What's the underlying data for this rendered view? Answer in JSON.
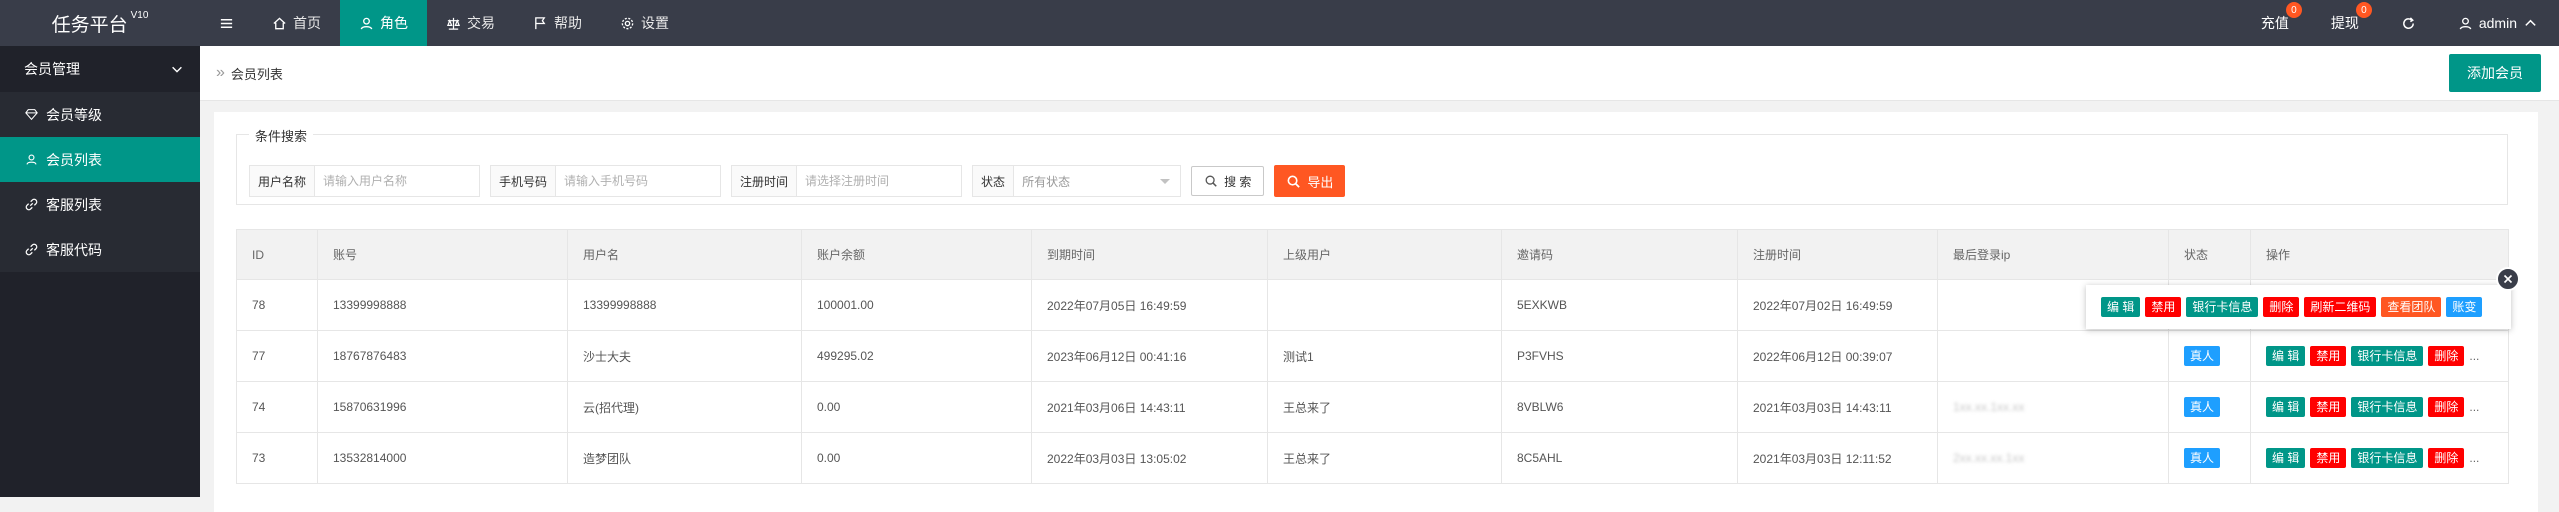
{
  "app": {
    "title": "任务平台",
    "version": "V10"
  },
  "topnav": [
    {
      "label": "",
      "icon": "menu-icon"
    },
    {
      "label": "首页",
      "icon": "home-icon"
    },
    {
      "label": "角色",
      "icon": "user-icon",
      "active": true
    },
    {
      "label": "交易",
      "icon": "scale-icon"
    },
    {
      "label": "帮助",
      "icon": "flag-icon"
    },
    {
      "label": "设置",
      "icon": "gear-icon"
    }
  ],
  "topright": {
    "recharge": {
      "label": "充值",
      "badge": "0"
    },
    "withdraw": {
      "label": "提现",
      "badge": "0"
    },
    "refresh_icon": "refresh-icon",
    "user": "admin"
  },
  "sidebar": {
    "group": "会员管理",
    "items": [
      {
        "label": "会员等级",
        "icon": "diamond-icon"
      },
      {
        "label": "会员列表",
        "icon": "user-icon",
        "active": true
      },
      {
        "label": "客服列表",
        "icon": "link-icon"
      },
      {
        "label": "客服代码",
        "icon": "link-icon"
      }
    ]
  },
  "header": {
    "breadcrumb": "会员列表",
    "add_button": "添加会员"
  },
  "search": {
    "legend": "条件搜索",
    "fields": [
      {
        "label": "用户名称",
        "placeholder": "请输入用户名称"
      },
      {
        "label": "手机号码",
        "placeholder": "请输入手机号码"
      },
      {
        "label": "注册时间",
        "placeholder": "请选择注册时间"
      }
    ],
    "status": {
      "label": "状态",
      "value": "所有状态"
    },
    "search_button": "搜 索",
    "export_button": "导出"
  },
  "table": {
    "columns": [
      "ID",
      "账号",
      "用户名",
      "账户余额",
      "到期时间",
      "上级用户",
      "邀请码",
      "注册时间",
      "最后登录ip",
      "状态",
      "操作"
    ],
    "rows": [
      {
        "id": "78",
        "account": "13399998888",
        "username": "13399998888",
        "balance": "100001.00",
        "expire": "2022年07月05日 16:49:59",
        "parent": "",
        "invite": "5EXKWB",
        "register": "2022年07月02日 16:49:59",
        "ip": "",
        "status": ""
      },
      {
        "id": "77",
        "account": "18767876483",
        "username": "沙士大夫",
        "balance": "499295.02",
        "expire": "2023年06月12日 00:41:16",
        "parent": "测试1",
        "invite": "P3FVHS",
        "register": "2022年06月12日 00:39:07",
        "ip": "",
        "status": "真人"
      },
      {
        "id": "74",
        "account": "15870631996",
        "username": "云(招代理)",
        "balance": "0.00",
        "expire": "2021年03月06日 14:43:11",
        "parent": "王总来了",
        "invite": "8VBLW6",
        "register": "2021年03月03日 14:43:11",
        "ip": "1xx.xx.1xx.xx",
        "status": "真人"
      },
      {
        "id": "73",
        "account": "13532814000",
        "username": "造梦团队",
        "balance": "0.00",
        "expire": "2022年03月03日 13:05:02",
        "parent": "王总来了",
        "invite": "8C5AHL",
        "register": "2021年03月03日 12:11:52",
        "ip": "2xx.xx.xx.1xx",
        "status": "真人"
      }
    ],
    "actions": {
      "edit": "编 辑",
      "disable": "禁用",
      "bank": "银行卡信息",
      "delete": "删除",
      "more": "..."
    }
  },
  "popup": {
    "actions": [
      "编 辑",
      "禁用",
      "银行卡信息",
      "删除",
      "刷新二维码",
      "查看团队",
      "账变"
    ]
  },
  "colors": {
    "accent": "#009688",
    "topbar": "#393d49",
    "sidebar": "#20222a",
    "danger": "#ff0000",
    "warning": "#ff5722",
    "info": "#1e9fff"
  }
}
